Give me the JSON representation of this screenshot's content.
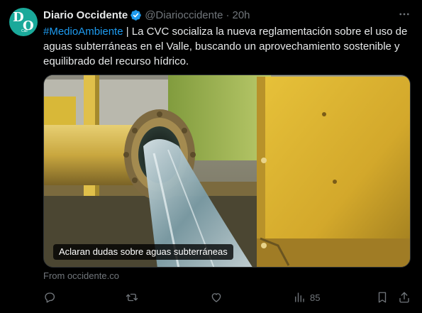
{
  "tweet": {
    "author_name": "Diario Occidente",
    "handle": "@Diarioccidente",
    "separator": "·",
    "time": "20h",
    "hashtag": "#MedioAmbiente",
    "text": " | La CVC socializa la nueva reglamentación sobre el uso de aguas subterráneas en el Valle, buscando un aprovechamiento sostenible y equilibrado del recurso hídrico.",
    "media_caption": "Aclaran dudas sobre aguas subterráneas",
    "source_label": "From occidente.co",
    "views_count": "85"
  },
  "avatar": {
    "letter_1": "D",
    "letter_2": "O",
    "sub_label": "Cali",
    "bg_color": "#1aa99a"
  },
  "colors": {
    "background": "#000000",
    "text": "#e7e9ea",
    "secondary": "#71767b",
    "link": "#1d9bf0",
    "verified": "#1d9bf0"
  },
  "icons": {
    "verified": "verified-badge-icon",
    "more": "more-options-icon",
    "reply": "reply-icon",
    "retweet": "retweet-icon",
    "like": "heart-icon",
    "views": "views-bar-chart-icon",
    "bookmark": "bookmark-icon",
    "share": "share-icon"
  }
}
